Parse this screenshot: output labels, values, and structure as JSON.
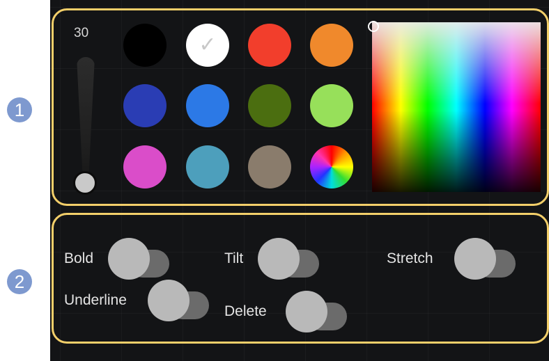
{
  "markers": [
    "1",
    "2"
  ],
  "brush": {
    "size_label": "30",
    "size_level": 0.0
  },
  "colors": [
    {
      "name": "black",
      "hex": "#000000",
      "selected": false
    },
    {
      "name": "white",
      "hex": "#ffffff",
      "selected": true
    },
    {
      "name": "red",
      "hex": "#f23e2c",
      "selected": false
    },
    {
      "name": "orange",
      "hex": "#f0892c",
      "selected": false
    },
    {
      "name": "dark-blue",
      "hex": "#2a3db4",
      "selected": false
    },
    {
      "name": "blue",
      "hex": "#2c79e6",
      "selected": false
    },
    {
      "name": "dark-green",
      "hex": "#4b6e10",
      "selected": false
    },
    {
      "name": "light-green",
      "hex": "#97e05a",
      "selected": false
    },
    {
      "name": "magenta",
      "hex": "#da4dc9",
      "selected": false
    },
    {
      "name": "teal",
      "hex": "#4d9fbc",
      "selected": false
    },
    {
      "name": "taupe",
      "hex": "#8a7c6c",
      "selected": false
    },
    {
      "name": "color-wheel",
      "hex": "",
      "selected": false
    }
  ],
  "check_glyph": "✓",
  "picker": {
    "icon": "hue-saturation-gradient"
  },
  "toggles": {
    "bold": {
      "label": "Bold",
      "on": false
    },
    "tilt": {
      "label": "Tilt",
      "on": false
    },
    "stretch": {
      "label": "Stretch",
      "on": false
    },
    "underline": {
      "label": "Underline",
      "on": false
    },
    "delete": {
      "label": "Delete",
      "on": false
    }
  },
  "accent_colors": {
    "highlight_frame": "#f3cf6a",
    "marker": "#7e99cf",
    "panel_bg": "#131416"
  }
}
